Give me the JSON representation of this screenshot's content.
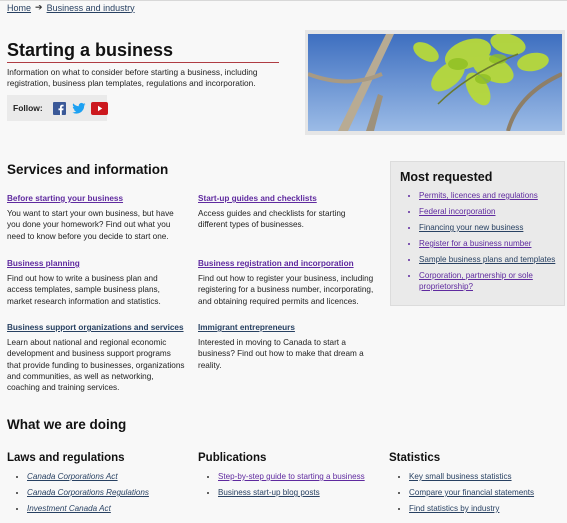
{
  "breadcrumb": {
    "home": "Home",
    "arrow": "➔",
    "current": "Business and industry"
  },
  "page": {
    "title": "Starting a business",
    "intro": "Information on what to consider before starting a business, including registration, business plan templates, regulations and incorporation."
  },
  "follow": {
    "label": "Follow:",
    "icons": [
      "facebook-icon",
      "twitter-icon",
      "youtube-icon"
    ]
  },
  "colors": {
    "link": "#284162",
    "visited": "#5f2a9f",
    "rule": "#af3c43",
    "youtube": "#cc181e",
    "facebook": "#3b5998",
    "twitter": "#1da1f2"
  },
  "services": {
    "heading": "Services and information",
    "items": [
      {
        "title": "Before starting your business",
        "desc": "You want to start your own business, but have you done your homework? Find out what you need to know before you decide to start one."
      },
      {
        "title": "Start-up guides and checklists",
        "desc": "Access guides and checklists for starting different types of businesses."
      },
      {
        "title": "Business planning",
        "desc": "Find out how to write a business plan and access templates, sample business plans, market research information and statistics."
      },
      {
        "title": "Business registration and incorporation",
        "desc": "Find out how to register your business, including registering for a business number, incorporating, and obtaining required permits and licences."
      },
      {
        "title": "Business support organizations and services",
        "desc": "Learn about national and regional economic development and business support programs that provide funding to businesses, organizations and communities, as well as networking, coaching and training services."
      },
      {
        "title": "Immigrant entrepreneurs",
        "desc": "Interested in moving to Canada to start a business? Find out how to make that dream a reality."
      }
    ]
  },
  "most_requested": {
    "heading": "Most requested",
    "items": [
      "Permits, licences and regulations",
      "Federal incorporation",
      "Financing your new business",
      "Register for a business number",
      "Sample business plans and templates",
      "Corporation, partnership or sole proprietorship?"
    ]
  },
  "doing": {
    "heading": "What we are doing",
    "laws": {
      "heading": "Laws and regulations",
      "items": [
        "Canada Corporations Act",
        "Canada Corporations Regulations",
        "Investment Canada Act"
      ]
    },
    "publications": {
      "heading": "Publications",
      "items": [
        "Step-by-step guide to starting a business",
        "Business start-up blog posts"
      ]
    },
    "statistics": {
      "heading": "Statistics",
      "items": [
        "Key small business statistics",
        "Compare your financial statements",
        "Find statistics by industry"
      ]
    }
  }
}
